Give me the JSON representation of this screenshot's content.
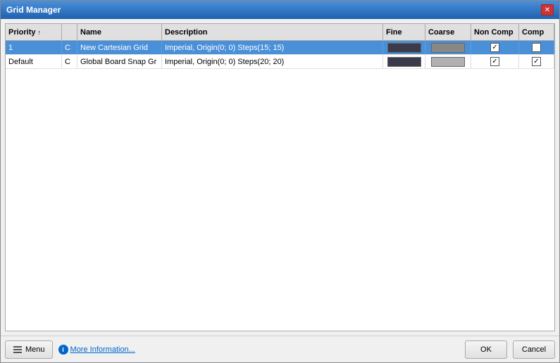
{
  "window": {
    "title": "Grid Manager"
  },
  "table": {
    "columns": [
      {
        "id": "priority",
        "label": "Priority",
        "sort": true
      },
      {
        "id": "type",
        "label": ""
      },
      {
        "id": "name",
        "label": "Name"
      },
      {
        "id": "description",
        "label": "Description"
      },
      {
        "id": "fine",
        "label": "Fine"
      },
      {
        "id": "coarse",
        "label": "Coarse"
      },
      {
        "id": "noncomp",
        "label": "Non Comp"
      },
      {
        "id": "comp",
        "label": "Comp"
      }
    ],
    "rows": [
      {
        "id": 1,
        "priority": "1",
        "type": "C",
        "name": "New Cartesian Grid",
        "description": "Imperial, Origin(0; 0) Steps(15; 15)",
        "fine_color": "#3a3a4a",
        "coarse_color": "#888888",
        "noncomp_checked": true,
        "comp_checked": false,
        "selected": true
      },
      {
        "id": 2,
        "priority": "Default",
        "type": "C",
        "name": "Global Board Snap Gr",
        "description": "Imperial, Origin(0; 0) Steps(20; 20)",
        "fine_color": "#3a3a4a",
        "coarse_color": "#b0b0b0",
        "noncomp_checked": true,
        "comp_checked": true,
        "selected": false
      }
    ]
  },
  "footer": {
    "menu_label": "Menu",
    "info_label": "More Information...",
    "ok_label": "OK",
    "cancel_label": "Cancel"
  }
}
